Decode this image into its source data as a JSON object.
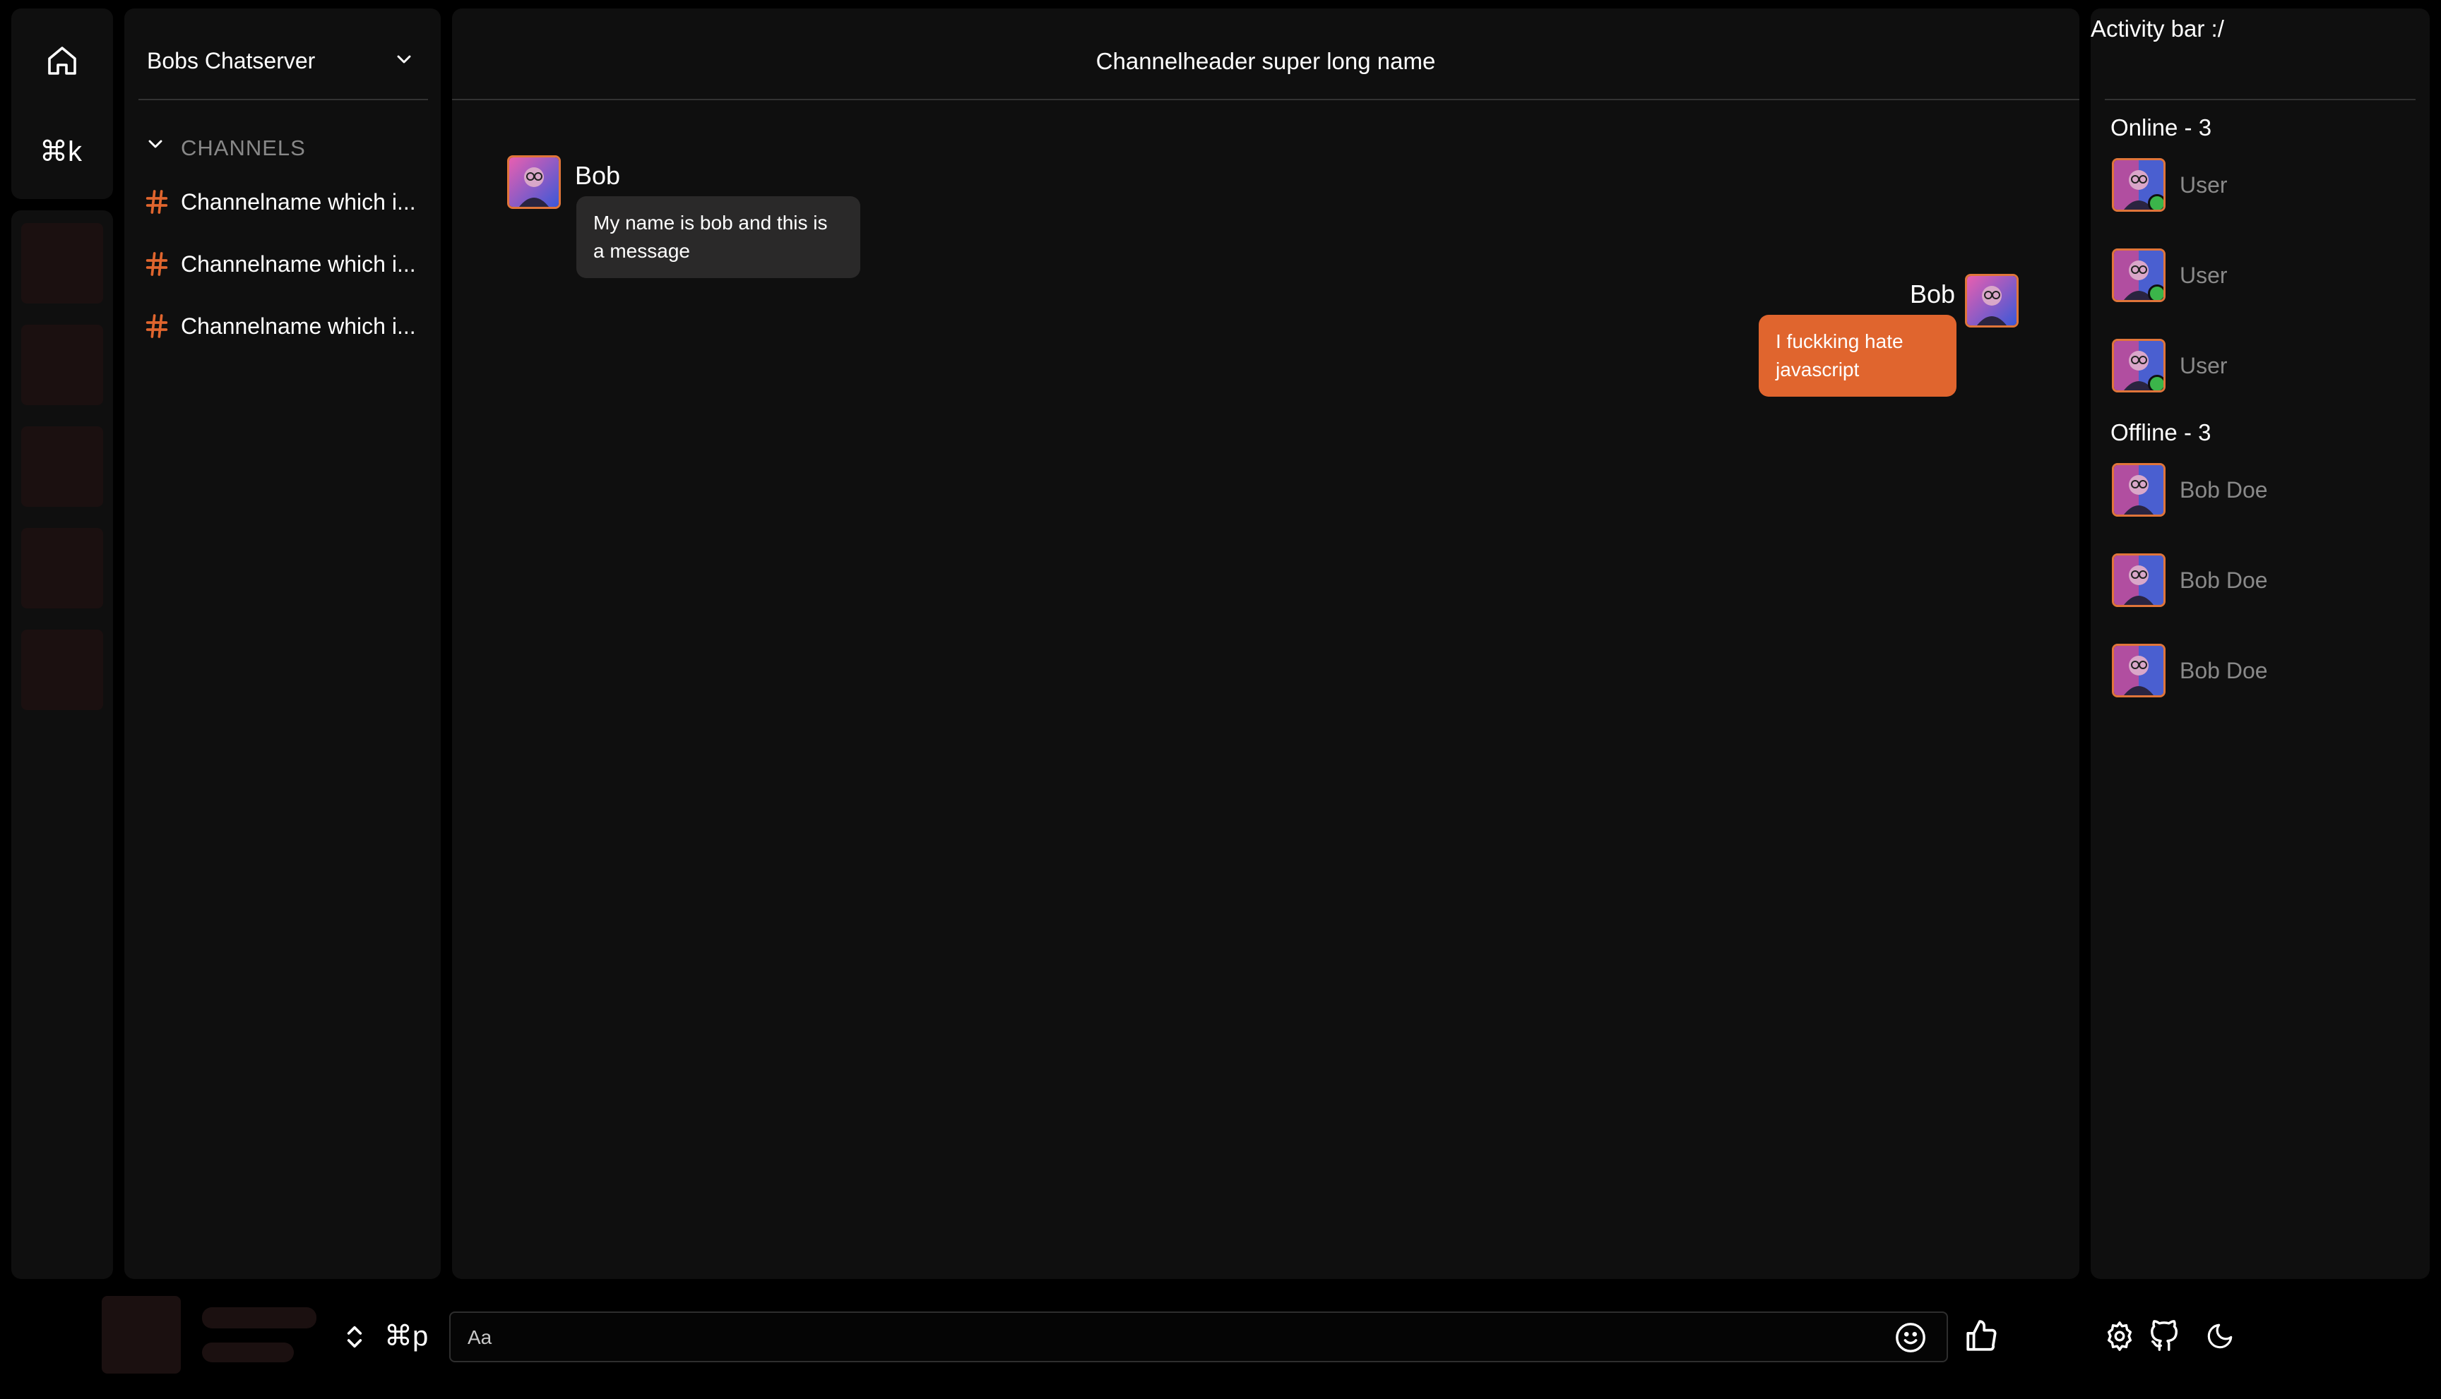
{
  "rail": {
    "home_icon": "home-icon",
    "shortcut_label": "⌘k",
    "server_slots": 5
  },
  "sidebar": {
    "server_name": "Bobs Chatserver",
    "section_label": "CHANNELS",
    "channels": [
      {
        "name": "Channelname which i..."
      },
      {
        "name": "Channelname which i..."
      },
      {
        "name": "Channelname which i..."
      }
    ]
  },
  "chat": {
    "title": "Channelheader super long name",
    "messages": [
      {
        "sender": "Bob",
        "text": "My name is bob and this is a message",
        "side": "left"
      },
      {
        "sender": "Bob",
        "text": "I fuckking hate javascript",
        "side": "right"
      }
    ]
  },
  "activity": {
    "title": "Activity bar :/",
    "online_label": "Online - 3",
    "offline_label": "Offline - 3",
    "online": [
      {
        "name": "User"
      },
      {
        "name": "User"
      },
      {
        "name": "User"
      }
    ],
    "offline": [
      {
        "name": "Bob Doe"
      },
      {
        "name": "Bob Doe"
      },
      {
        "name": "Bob Doe"
      }
    ]
  },
  "bottom": {
    "shortcut_label": "⌘p",
    "composer_placeholder": "Aa"
  },
  "colors": {
    "accent": "#e0652e",
    "panel": "#0f0f0f",
    "online": "#3bb54a"
  }
}
